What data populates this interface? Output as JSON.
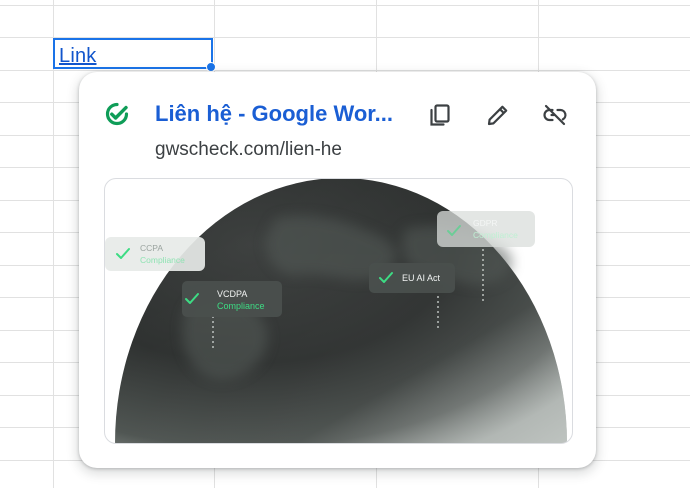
{
  "sheet": {
    "cell_text": "Link"
  },
  "link_card": {
    "title": "Liên hệ - Google Wor...",
    "url": "gwscheck.com/lien-he",
    "status_icon": "check-icon",
    "actions": [
      {
        "name": "copy-link-button",
        "icon": "copy-icon"
      },
      {
        "name": "edit-link-button",
        "icon": "pencil-icon"
      },
      {
        "name": "remove-link-button",
        "icon": "unlink-icon"
      }
    ],
    "preview": {
      "badges": [
        {
          "line1": "CCPA",
          "line2": "Compliance"
        },
        {
          "line1": "VCDPA",
          "line2": "Compliance"
        },
        {
          "line1": "EU AI Act",
          "line2": ""
        },
        {
          "line1": "GDPR",
          "line2": "Compliance"
        }
      ]
    }
  },
  "colors": {
    "accent": "#1a73e8",
    "link": "#1155cc",
    "title": "#1a5ed4",
    "check_green": "#0f9d58",
    "badge_green": "#3ddc84"
  }
}
